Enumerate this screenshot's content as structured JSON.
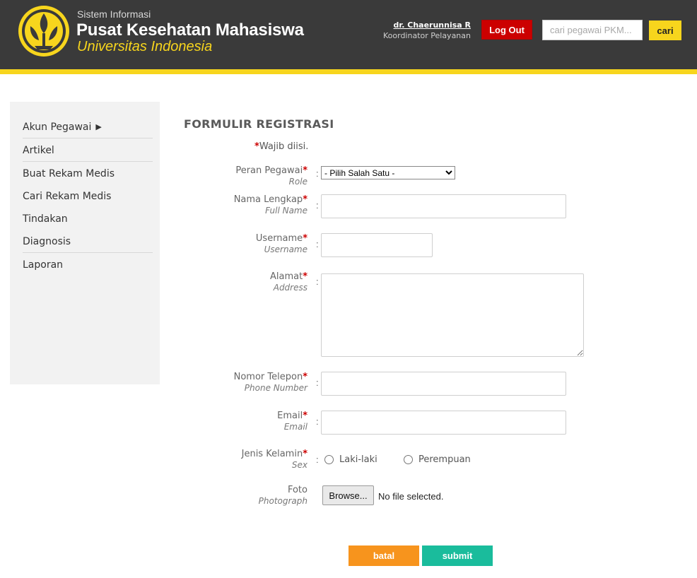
{
  "header": {
    "subtitle": "Sistem Informasi",
    "title": "Pusat Kesehatan Mahasiswa",
    "university": "Universitas Indonesia",
    "user_name": "dr. Chaerunnisa R",
    "user_role": "Koordinator Pelayanan",
    "logout_label": "Log Out",
    "search_placeholder": "cari pegawai PKM...",
    "search_label": "cari",
    "colors": {
      "bar": "#3a3a3a",
      "accent": "#f7d51d",
      "logout": "#cc0000"
    }
  },
  "sidebar": {
    "items": [
      {
        "label": "Akun Pegawai",
        "arrow": "▶"
      },
      {
        "label": "Artikel"
      },
      {
        "label": "Buat Rekam Medis"
      },
      {
        "label": "Cari Rekam Medis"
      },
      {
        "label": "Tindakan"
      },
      {
        "label": "Diagnosis"
      },
      {
        "label": "Laporan"
      }
    ]
  },
  "form": {
    "title": "FORMULIR REGISTRASI",
    "required_note": "Wajib diisi.",
    "required_mark": "*",
    "colon": ":",
    "fields": {
      "role": {
        "label": "Peran Pegawai",
        "sublabel": "Role",
        "selected": "- Pilih Salah Satu -"
      },
      "fullname": {
        "label": "Nama Lengkap",
        "sublabel": "Full Name",
        "value": ""
      },
      "username": {
        "label": "Username",
        "sublabel": "Username",
        "value": ""
      },
      "address": {
        "label": "Alamat",
        "sublabel": "Address",
        "value": ""
      },
      "phone": {
        "label": "Nomor Telepon",
        "sublabel": "Phone Number",
        "value": ""
      },
      "email": {
        "label": "Email",
        "sublabel": "Email",
        "value": ""
      },
      "sex": {
        "label": "Jenis Kelamin",
        "sublabel": "Sex",
        "options": [
          "Laki-laki",
          "Perempuan"
        ]
      },
      "photo": {
        "label": "Foto",
        "sublabel": "Photograph",
        "browse_label": "Browse...",
        "status": "No file selected."
      }
    },
    "cancel_label": "batal",
    "submit_label": "submit",
    "colors": {
      "cancel": "#f7941d",
      "submit": "#1abc9c"
    }
  }
}
